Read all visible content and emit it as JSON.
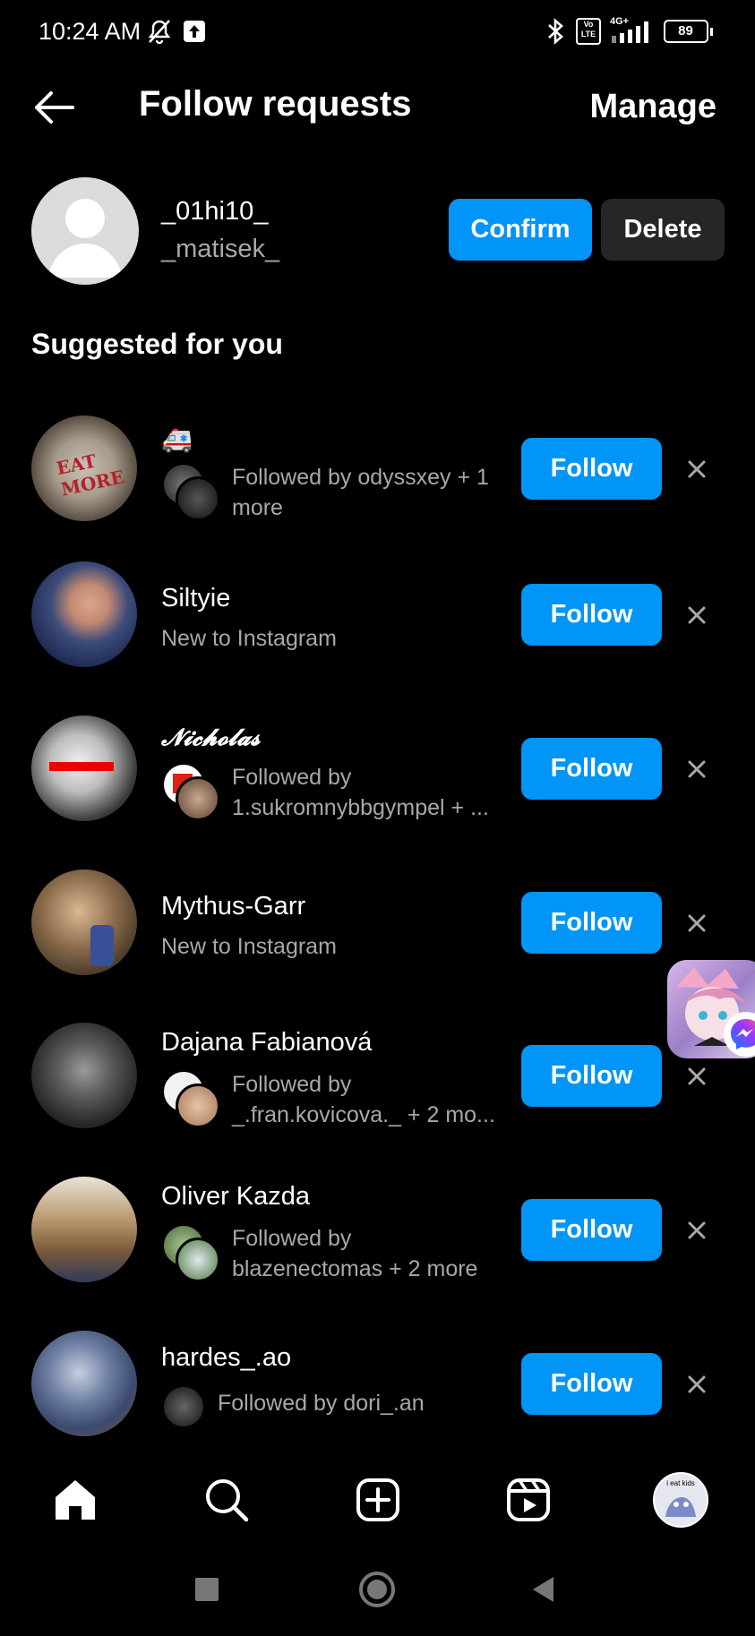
{
  "status_bar": {
    "time": "10:24 AM",
    "icons": [
      "mute-bell-icon",
      "upload-icon",
      "bluetooth-icon",
      "volte-icon",
      "signal-icon",
      "battery-icon"
    ],
    "network": "4G+",
    "volte": "Vo LTE",
    "battery": "89"
  },
  "header": {
    "title": "Follow requests",
    "manage_label": "Manage"
  },
  "request": {
    "username": "_01hi10_",
    "name": "_matisek_",
    "confirm_label": "Confirm",
    "delete_label": "Delete"
  },
  "suggested_title": "Suggested for you",
  "suggestions": [
    {
      "name": "🚑",
      "sub": "Followed by odyssxey + 1 more",
      "follow_label": "Follow"
    },
    {
      "name": "Siltyie",
      "sub": "New to Instagram",
      "follow_label": "Follow"
    },
    {
      "name": "𝓝𝓲𝓬𝓱𝓸𝓵𝓪𝓼",
      "sub": "Followed by 1.sukromnybbgympel + ...",
      "follow_label": "Follow"
    },
    {
      "name": "Mythus-Garr",
      "sub": "New to Instagram",
      "follow_label": "Follow"
    },
    {
      "name": "Dajana Fabianová",
      "sub": "Followed by _.fran.kovicova._ + 2 mo...",
      "follow_label": "Follow"
    },
    {
      "name": "Oliver Kazda",
      "sub": "Followed by blazenectomas + 2 more",
      "follow_label": "Follow"
    },
    {
      "name": "hardes_.ao",
      "sub": "Followed by dori_.an",
      "follow_label": "Follow"
    }
  ],
  "profile_avatar_text": "i eat kids",
  "colors": {
    "accent": "#0095f6",
    "secondary_button": "#262626",
    "background": "#000000",
    "muted_text": "#a8a8a8"
  }
}
